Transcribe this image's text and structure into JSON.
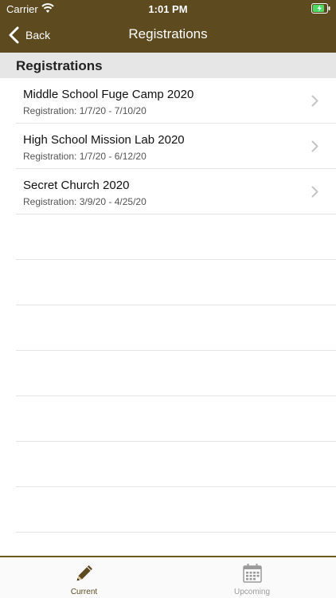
{
  "status_bar": {
    "carrier": "Carrier",
    "time": "1:01 PM"
  },
  "nav": {
    "back_label": "Back",
    "title": "Registrations"
  },
  "section": {
    "title": "Registrations"
  },
  "registrations": [
    {
      "title": "Middle School Fuge Camp 2020",
      "subtitle": "Registration: 1/7/20 - 7/10/20"
    },
    {
      "title": "High School Mission Lab 2020",
      "subtitle": "Registration: 1/7/20 - 6/12/20"
    },
    {
      "title": "Secret Church 2020",
      "subtitle": "Registration: 3/9/20 - 4/25/20"
    }
  ],
  "tabs": [
    {
      "label": "Current",
      "icon": "pencil-icon",
      "selected": true
    },
    {
      "label": "Upcoming",
      "icon": "calendar-icon",
      "selected": false
    }
  ],
  "colors": {
    "accent": "#5d4a1f",
    "inactive": "#9a9a9a"
  }
}
